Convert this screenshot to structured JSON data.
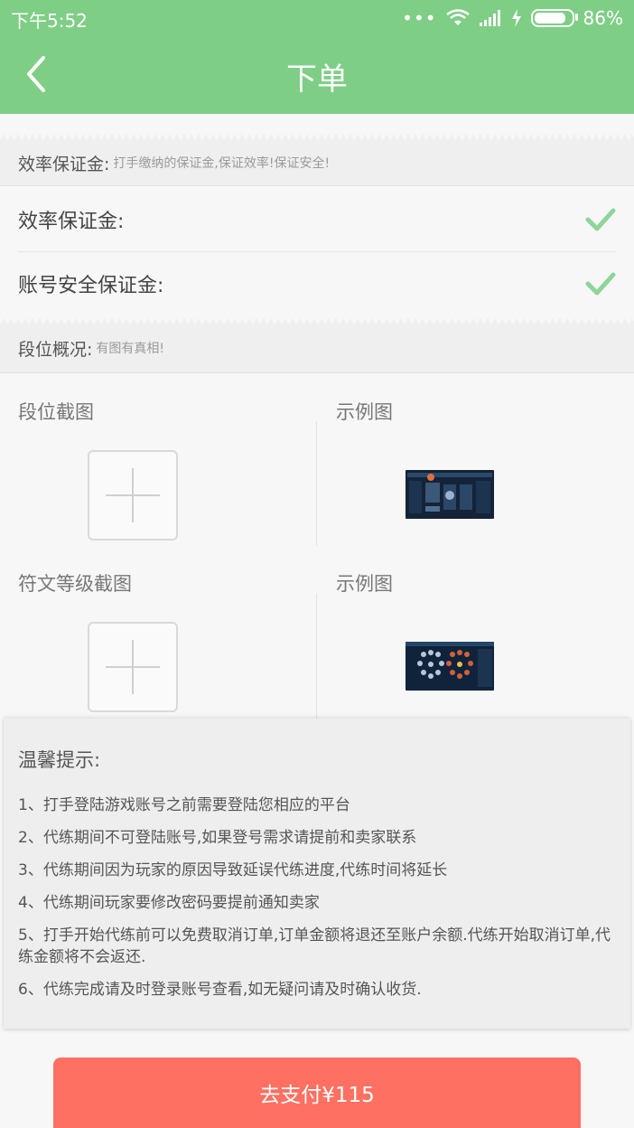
{
  "colors": {
    "header": "#7fce86",
    "check": "#8fd49a",
    "pay_button": "#fe7061"
  },
  "status_bar": {
    "time": "下午5:52",
    "signal_dots": "•••",
    "battery_text": "86%",
    "battery_level": 0.86
  },
  "header": {
    "back_icon": "chevron-left-icon",
    "title": "下单"
  },
  "efficiency_section": {
    "title": "效率保证金:",
    "desc": "打手缴纳的保证金,保证效率!保证安全!"
  },
  "options": [
    {
      "label": "效率保证金:",
      "checked": true
    },
    {
      "label": "账号安全保证金:",
      "checked": true
    }
  ],
  "rank_section": {
    "title": "段位概况:",
    "desc": "有图有真相!"
  },
  "screenshots": [
    {
      "upload_label": "段位截图",
      "example_label": "示例图"
    },
    {
      "upload_label": "符文等级截图",
      "example_label": "示例图"
    }
  ],
  "tips": {
    "title": "温馨提示:",
    "items": [
      "1、打手登陆游戏账号之前需要登陆您相应的平台",
      "2、代练期间不可登陆账号,如果登号需求请提前和卖家联系",
      "3、代练期间因为玩家的原因导致延误代练进度,代练时间将延长",
      "4、代练期间玩家要修改密码要提前通知卖家",
      "5、打手开始代练前可以免费取消订单,订单金额将退还至账户余额.代练开始取消订单,代练金额将不会返还.",
      "6、代练完成请及时登录账号查看,如无疑问请及时确认收货."
    ]
  },
  "pay_button": {
    "label": "去支付¥115"
  }
}
